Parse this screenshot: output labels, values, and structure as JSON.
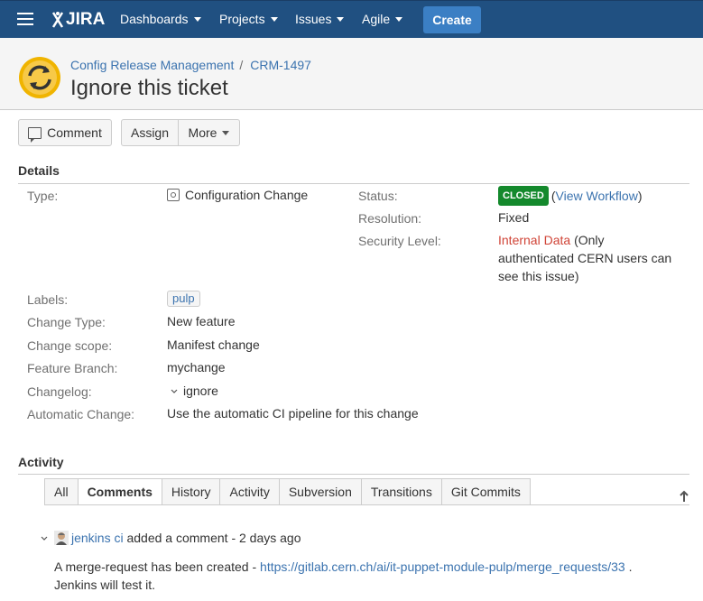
{
  "nav": {
    "logo_text": "JIRA",
    "items": [
      {
        "label": "Dashboards"
      },
      {
        "label": "Projects"
      },
      {
        "label": "Issues"
      },
      {
        "label": "Agile"
      }
    ],
    "create_label": "Create",
    "bar_color": "#205081",
    "create_color": "#3b7fc4"
  },
  "header": {
    "project_name": "Config Release Management",
    "issue_key": "CRM-1497",
    "title": "Ignore this ticket"
  },
  "toolbar": {
    "comment_label": "Comment",
    "assign_label": "Assign",
    "more_label": "More"
  },
  "details": {
    "heading": "Details",
    "type_label": "Type:",
    "type_value": "Configuration Change",
    "status_label": "Status:",
    "status_value": "CLOSED",
    "status_color": "#14892c",
    "view_workflow": "View Workflow",
    "resolution_label": "Resolution:",
    "resolution_value": "Fixed",
    "security_label": "Security Level:",
    "security_value": "Internal Data",
    "security_note": "(Only authenticated CERN users can see this issue)",
    "labels_label": "Labels:",
    "labels_value": "pulp",
    "change_type_label": "Change Type:",
    "change_type_value": "New feature",
    "change_scope_label": "Change scope:",
    "change_scope_value": "Manifest change",
    "feature_branch_label": "Feature Branch:",
    "feature_branch_value": "mychange",
    "changelog_label": "Changelog:",
    "changelog_value": "ignore",
    "auto_change_label": "Automatic Change:",
    "auto_change_value": "Use the automatic CI pipeline for this change"
  },
  "activity": {
    "heading": "Activity",
    "tabs": [
      "All",
      "Comments",
      "History",
      "Activity",
      "Subversion",
      "Transitions",
      "Git Commits"
    ],
    "active_tab": "Comments",
    "comment": {
      "author": "jenkins ci",
      "action": "added a comment - 2 days ago",
      "body_prefix": "A merge-request has been created - ",
      "link": "https://gitlab.cern.ch/ai/it-puppet-module-pulp/merge_requests/33",
      "body_suffix": " .",
      "body_line2": "Jenkins will test it."
    }
  }
}
